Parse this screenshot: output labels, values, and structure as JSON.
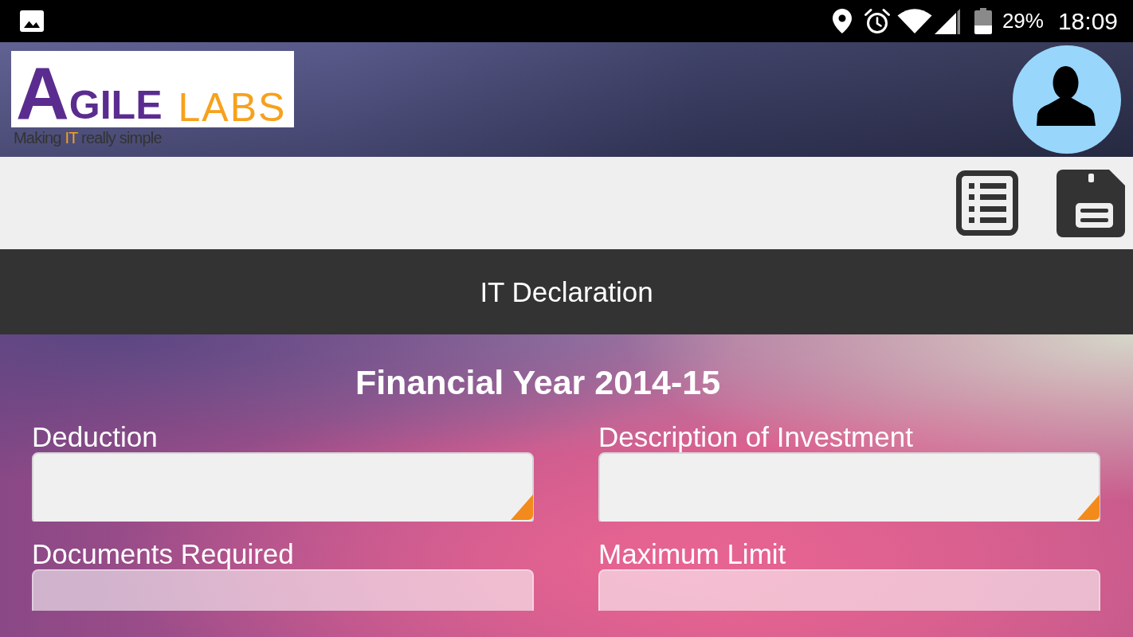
{
  "status_bar": {
    "battery_text": "29%",
    "time": "18:09"
  },
  "header": {
    "logo": {
      "words": [
        {
          "text": "AGILE",
          "accent": false
        },
        {
          "text": "LABS",
          "accent": true
        }
      ],
      "tagline": [
        {
          "text": "Making",
          "accent": false
        },
        {
          "text": "IT",
          "accent": true
        },
        {
          "text": "really simple",
          "accent": false
        }
      ]
    }
  },
  "title_bar": {
    "title": "IT Declaration"
  },
  "form": {
    "heading": "Financial Year 2014-15",
    "fields": [
      {
        "label": "Deduction",
        "kind": "select",
        "disabled": false
      },
      {
        "label": "Description of Investment",
        "kind": "select",
        "disabled": false
      },
      {
        "label": "Documents Required",
        "kind": "text",
        "disabled": true
      },
      {
        "label": "Maximum Limit",
        "kind": "text",
        "disabled": true
      }
    ]
  }
}
